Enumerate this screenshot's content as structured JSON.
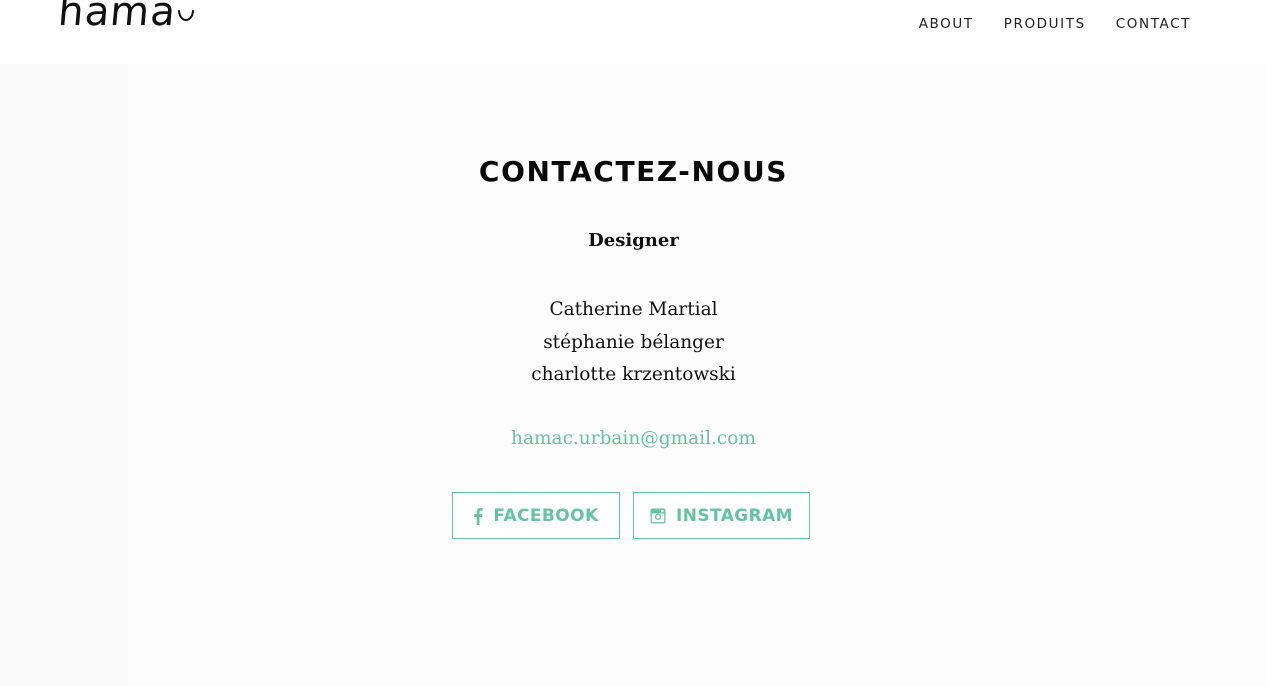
{
  "header": {
    "logo_text": "hama",
    "nav": [
      {
        "label": "ABOUT"
      },
      {
        "label": "PRODUITS"
      },
      {
        "label": "CONTACT"
      }
    ]
  },
  "contact": {
    "title": "CONTACTEZ-NOUS",
    "role": "Designer",
    "people": [
      "Catherine Martial",
      "stéphanie bélanger",
      "charlotte krzentowski"
    ],
    "email": "hamac.urbain@gmail.com",
    "social": {
      "facebook_label": "FACEBOOK",
      "instagram_label": "INSTAGRAM"
    }
  },
  "icons": {
    "facebook": "facebook-icon",
    "instagram": "instagram-icon"
  },
  "colors": {
    "accent": "#63c5a0",
    "text": "#111111",
    "background": "#f9f9f9"
  }
}
